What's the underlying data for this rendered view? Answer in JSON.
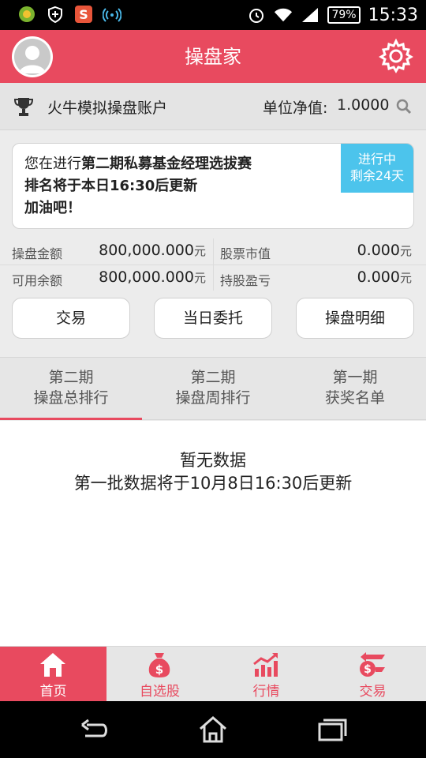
{
  "status_bar": {
    "battery": "79%",
    "time": "15:33",
    "icons": [
      "clover-icon",
      "shield-icon",
      "s-app-icon",
      "wifi-hotspot-icon",
      "alarm-icon",
      "wifi-icon",
      "signal-icon",
      "battery-icon"
    ]
  },
  "header": {
    "title": "操盘家",
    "avatar_icon": "user-avatar-icon",
    "settings_icon": "gear-icon",
    "color": "#e84a5f"
  },
  "account": {
    "name": "火牛模拟操盘账户",
    "nav_label": "单位净值:",
    "nav_value": "1.0000"
  },
  "notice": {
    "line1_prefix": "您在进行",
    "line1_bold": "第二期私募基金经理选拔赛",
    "line2": "排名将于本日16:30后更新",
    "line3": "加油吧！",
    "badge_line1": "进行中",
    "badge_line2": "剩余24天",
    "badge_color": "#4cc4ec"
  },
  "stats": [
    {
      "label": "操盘金额",
      "value": "800,000.000",
      "unit": "元",
      "label2": "股票市值",
      "value2": "0.000",
      "unit2": "元"
    },
    {
      "label": "可用余额",
      "value": "800,000.000",
      "unit": "元",
      "label2": "持股盈亏",
      "value2": "0.000",
      "unit2": "元"
    }
  ],
  "actions": [
    "交易",
    "当日委托",
    "操盘明细"
  ],
  "tabs": [
    {
      "line1": "第二期",
      "line2": "操盘总排行",
      "active": true
    },
    {
      "line1": "第二期",
      "line2": "操盘周排行",
      "active": false
    },
    {
      "line1": "第一期",
      "line2": "获奖名单",
      "active": false
    }
  ],
  "content": {
    "empty_title": "暂无数据",
    "empty_sub": "第一批数据将于10月8日16:30后更新"
  },
  "bottom_nav": [
    {
      "label": "首页",
      "icon": "home-icon",
      "active": true
    },
    {
      "label": "自选股",
      "icon": "money-bag-icon",
      "active": false
    },
    {
      "label": "行情",
      "icon": "chart-icon",
      "active": false
    },
    {
      "label": "交易",
      "icon": "exchange-icon",
      "active": false
    }
  ],
  "system_nav": [
    "back-icon",
    "home-icon",
    "recent-apps-icon"
  ]
}
